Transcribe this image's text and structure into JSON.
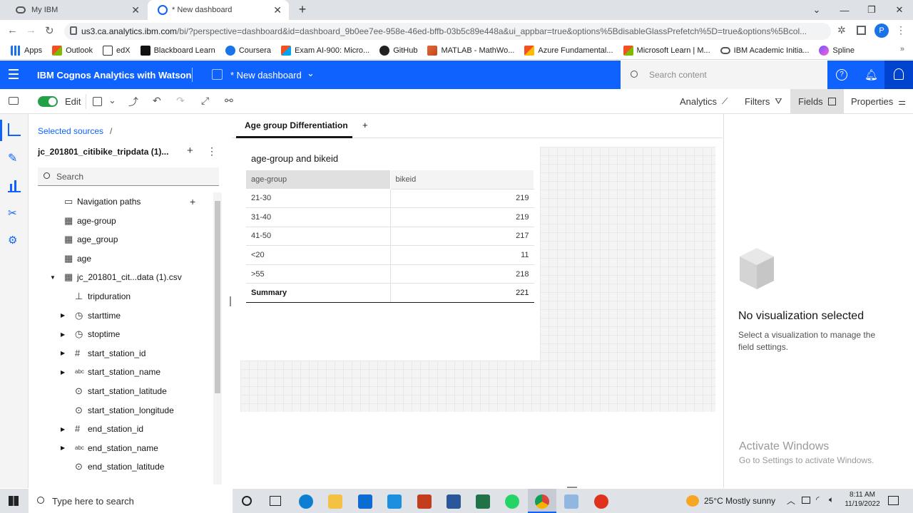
{
  "browser": {
    "tabs": [
      {
        "title": "My IBM"
      },
      {
        "title": "* New dashboard"
      }
    ],
    "url_host": "us3.ca.analytics.ibm.com",
    "url_path": "/bi/?perspective=dashboard&id=dashboard_9b0ee7ee-958e-46ed-bffb-03b5c89e448a&ui_appbar=true&options%5BdisableGlassPrefetch%5D=true&options%5Bcol...",
    "profile_initial": "P",
    "bookmarks": [
      "Apps",
      "Outlook",
      "edX",
      "Blackboard Learn",
      "Coursera",
      "Exam AI-900: Micro...",
      "GitHub",
      "MATLAB - MathWo...",
      "Azure Fundamental...",
      "Microsoft Learn | M...",
      "IBM Academic Initia...",
      "Spline"
    ]
  },
  "app": {
    "title": "IBM Cognos Analytics with Watson",
    "dashboard_name": "* New dashboard",
    "search_placeholder": "Search content"
  },
  "toolbar": {
    "edit_label": "Edit",
    "right_items": [
      "Analytics",
      "Filters",
      "Fields",
      "Properties"
    ]
  },
  "sources": {
    "breadcrumb": "Selected sources",
    "breadcrumb_sep": "/",
    "source_name": "jc_201801_citibike_tripdata (1)...",
    "search_placeholder": "Search",
    "tree": [
      {
        "label": "Navigation paths",
        "icon": "folder-icon",
        "level": 0,
        "caret": ""
      },
      {
        "label": "age-group",
        "icon": "table-icon",
        "level": 0,
        "caret": ""
      },
      {
        "label": "age_group",
        "icon": "table-icon",
        "level": 0,
        "caret": ""
      },
      {
        "label": "age",
        "icon": "table-icon",
        "level": 0,
        "caret": ""
      },
      {
        "label": "jc_201801_cit...data (1).csv",
        "icon": "table-icon",
        "level": 0,
        "caret": "down"
      },
      {
        "label": "tripduration",
        "icon": "measure-icon",
        "level": 1,
        "caret": ""
      },
      {
        "label": "starttime",
        "icon": "clock-icon",
        "level": 1,
        "caret": "right"
      },
      {
        "label": "stoptime",
        "icon": "clock-icon",
        "level": 1,
        "caret": "right"
      },
      {
        "label": "start_station_id",
        "icon": "hash-icon",
        "level": 1,
        "caret": "right"
      },
      {
        "label": "start_station_name",
        "icon": "abc-icon",
        "level": 1,
        "caret": "right"
      },
      {
        "label": "start_station_latitude",
        "icon": "pin-icon",
        "level": 1,
        "caret": ""
      },
      {
        "label": "start_station_longitude",
        "icon": "pin-icon",
        "level": 1,
        "caret": ""
      },
      {
        "label": "end_station_id",
        "icon": "hash-icon",
        "level": 1,
        "caret": "right"
      },
      {
        "label": "end_station_name",
        "icon": "abc-icon",
        "level": 1,
        "caret": "right"
      },
      {
        "label": "end_station_latitude",
        "icon": "pin-icon",
        "level": 1,
        "caret": ""
      }
    ]
  },
  "canvas": {
    "tab_label": "Age group Differentiation",
    "add_tab": "+",
    "widget_title": "age-group and bikeid",
    "table": {
      "columns": [
        "age-group",
        "bikeid"
      ],
      "rows": [
        [
          "21-30",
          "219"
        ],
        [
          "31-40",
          "219"
        ],
        [
          "41-50",
          "217"
        ],
        [
          "<20",
          "11"
        ],
        [
          ">55",
          "218"
        ]
      ],
      "summary": [
        "Summary",
        "221"
      ]
    }
  },
  "properties": {
    "empty_title": "No visualization selected",
    "empty_text": "Select a visualization to manage the field settings."
  },
  "watermark": {
    "title": "Activate Windows",
    "text": "Go to Settings to activate Windows."
  },
  "taskbar": {
    "search_placeholder": "Type here to search",
    "weather": "25°C  Mostly sunny",
    "time": "8:11 AM",
    "date": "11/19/2022"
  },
  "colors": {
    "accent": "#0f62fe",
    "toggle_on": "#24a148"
  }
}
